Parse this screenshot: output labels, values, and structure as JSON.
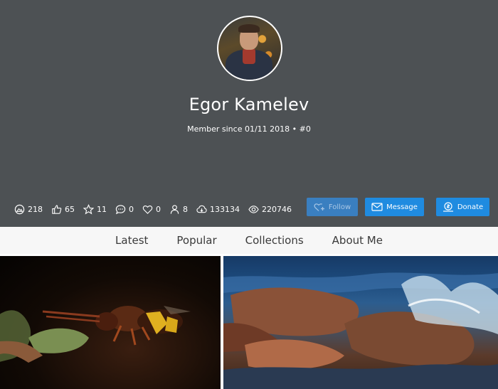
{
  "profile": {
    "name": "Egor Kamelev",
    "member_since": "Member since 01/11 2018 • #0"
  },
  "stats": [
    {
      "icon": "photos-icon",
      "value": "218"
    },
    {
      "icon": "likes-icon",
      "value": "65"
    },
    {
      "icon": "favorites-icon",
      "value": "11"
    },
    {
      "icon": "comments-icon",
      "value": "0"
    },
    {
      "icon": "hearts-icon",
      "value": "0"
    },
    {
      "icon": "followers-icon",
      "value": "8"
    },
    {
      "icon": "downloads-icon",
      "value": "133134"
    },
    {
      "icon": "views-icon",
      "value": "220746"
    }
  ],
  "buttons": {
    "follow": "Follow",
    "message": "Message",
    "donate": "Donate"
  },
  "tabs": [
    "Latest",
    "Popular",
    "Collections",
    "About Me"
  ],
  "colors": {
    "header_bg": "#4d5154",
    "button_blue": "#1f8be0",
    "tab_bar_bg": "#f7f7f7"
  }
}
